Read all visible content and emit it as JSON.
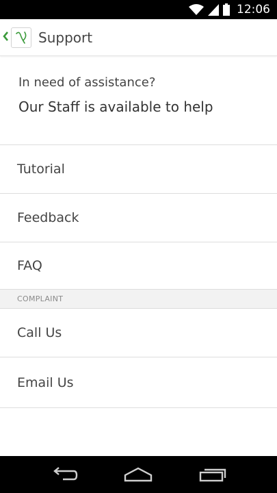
{
  "status_bar": {
    "time": "12:06",
    "icons": [
      "wifi-icon",
      "signal-icon",
      "battery-icon"
    ]
  },
  "action_bar": {
    "title": "Support",
    "up_icon": "chevron-left-icon",
    "app_icon": "app-logo-icon",
    "accent_color": "#3a9a3a"
  },
  "intro": {
    "question": "In need of assistance?",
    "subtitle": "Our Staff is available to help"
  },
  "menu": {
    "items": [
      {
        "label": "Tutorial"
      },
      {
        "label": "Feedback"
      },
      {
        "label": "FAQ"
      }
    ]
  },
  "complaint": {
    "header": "COMPLAINT",
    "items": [
      {
        "label": "Call Us"
      },
      {
        "label": "Email Us"
      }
    ]
  },
  "nav_bar": {
    "icons": [
      "back-icon",
      "home-icon",
      "recent-apps-icon"
    ]
  }
}
